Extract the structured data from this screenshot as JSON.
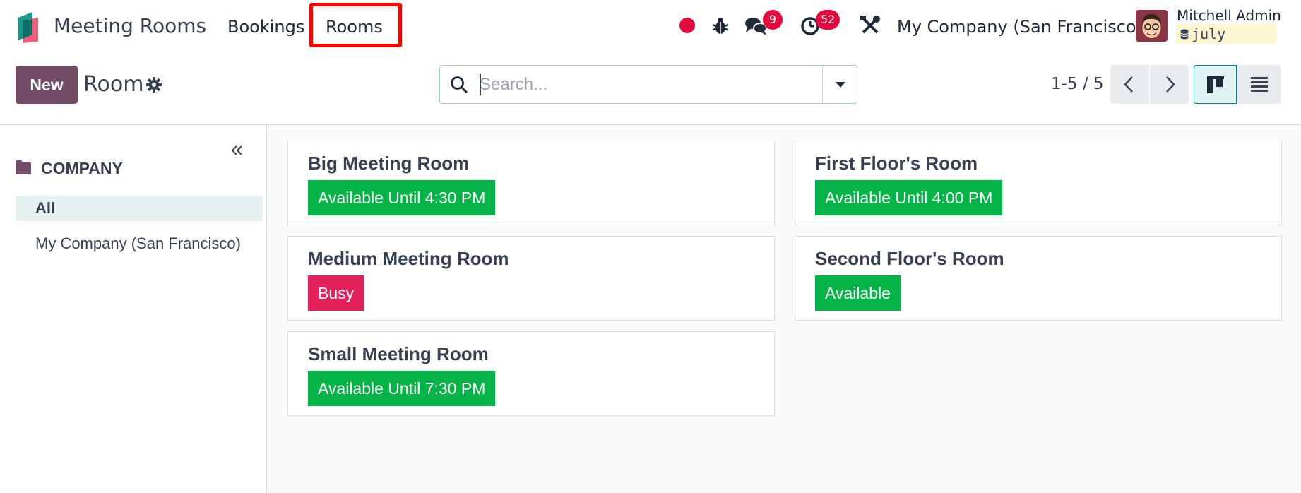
{
  "navbar": {
    "app_name": "Meeting Rooms",
    "menu": [
      "Bookings",
      "Rooms"
    ],
    "chat_count": "9",
    "activity_count": "52",
    "company": "My Company (San Francisco)",
    "user": {
      "name": "Mitchell Admin",
      "database": "july"
    }
  },
  "control_panel": {
    "new_label": "New",
    "title": "Room",
    "search_placeholder": "Search...",
    "pager": "1-5 / 5"
  },
  "side_panel": {
    "header": "COMPANY",
    "items": [
      "All",
      "My Company (San Francisco)"
    ]
  },
  "rooms": [
    {
      "name": "Big Meeting Room",
      "status": "Available Until 4:30 PM"
    },
    {
      "name": "First Floor's Room",
      "status": "Available Until 4:00 PM"
    },
    {
      "name": "Medium Meeting Room",
      "status": "Busy"
    },
    {
      "name": "Second Floor's Room",
      "status": "Available"
    },
    {
      "name": "Small Meeting Room",
      "status": "Available Until 7:30 PM"
    }
  ],
  "colors": {
    "brand": "#714b67",
    "available": "#05b447",
    "busy": "#e3225b",
    "highlight": "#ff0000"
  }
}
